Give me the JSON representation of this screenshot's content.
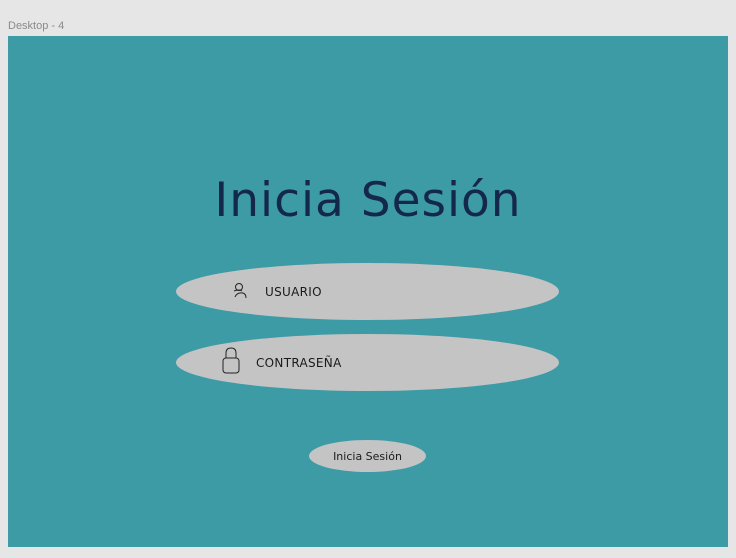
{
  "frame_label": "Desktop - 4",
  "login": {
    "title": "Inicia Sesión",
    "username_field": {
      "label": "USUARIO",
      "icon": "user-icon"
    },
    "password_field": {
      "label": "CONTRASEÑA",
      "icon": "lock-icon"
    },
    "submit_label": "Inicia Sesión"
  },
  "colors": {
    "canvas": "#e6e6e6",
    "frame_bg": "#3d9ba6",
    "title": "#13284a",
    "pill": "#c4c4c4"
  }
}
